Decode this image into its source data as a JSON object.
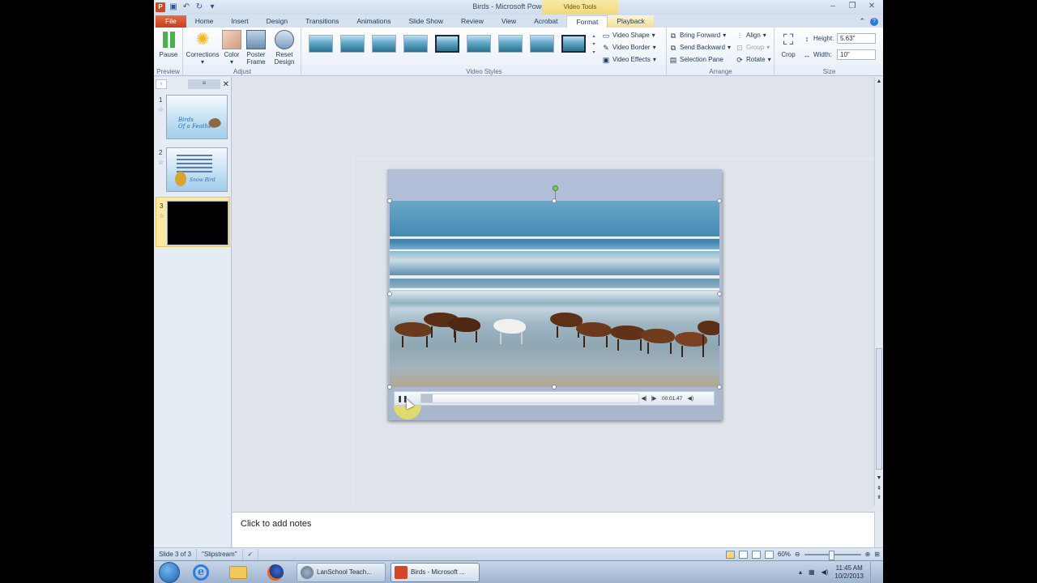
{
  "window": {
    "title": "Birds - Microsoft PowerPoint",
    "contextual_tools_label": "Video Tools"
  },
  "tabs": [
    {
      "label": "File"
    },
    {
      "label": "Home"
    },
    {
      "label": "Insert"
    },
    {
      "label": "Design"
    },
    {
      "label": "Transitions"
    },
    {
      "label": "Animations"
    },
    {
      "label": "Slide Show"
    },
    {
      "label": "Review"
    },
    {
      "label": "View"
    },
    {
      "label": "Acrobat"
    },
    {
      "label": "Format"
    },
    {
      "label": "Playback"
    }
  ],
  "ribbon": {
    "preview": {
      "pause": "Pause",
      "group": "Preview"
    },
    "adjust": {
      "corrections": "Corrections",
      "color": "Color",
      "poster": "Poster Frame",
      "reset": "Reset Design",
      "group": "Adjust"
    },
    "styles": {
      "group": "Video Styles",
      "shape": "Video Shape",
      "border": "Video Border",
      "effects": "Video Effects"
    },
    "arrange": {
      "bring_forward": "Bring Forward",
      "send_backward": "Send Backward",
      "selection_pane": "Selection Pane",
      "align": "Align",
      "group_btn": "Group",
      "rotate": "Rotate",
      "group": "Arrange"
    },
    "size": {
      "crop": "Crop",
      "height_label": "Height:",
      "height_value": "5.63\"",
      "width_label": "Width:",
      "width_value": "10\"",
      "group": "Size"
    }
  },
  "slides": [
    {
      "num": "1",
      "title_line1": "Birds",
      "title_line2": "Of a Feather"
    },
    {
      "num": "2",
      "label": "Snow Bird"
    },
    {
      "num": "3"
    }
  ],
  "player": {
    "time": "00:01.47"
  },
  "notes": {
    "placeholder": "Click to add notes"
  },
  "status": {
    "slide": "Slide 3 of 3",
    "theme": "\"Slipstream\"",
    "zoom": "60%"
  },
  "taskbar": {
    "task1": "LanSchool Teach...",
    "task2": "Birds - Microsoft ...",
    "time": "11:45 AM",
    "date": "10/2/2013"
  },
  "colors": {
    "accent_file": "#d24726",
    "selected_slide": "#fde8a1",
    "contextual": "#f0d879"
  }
}
